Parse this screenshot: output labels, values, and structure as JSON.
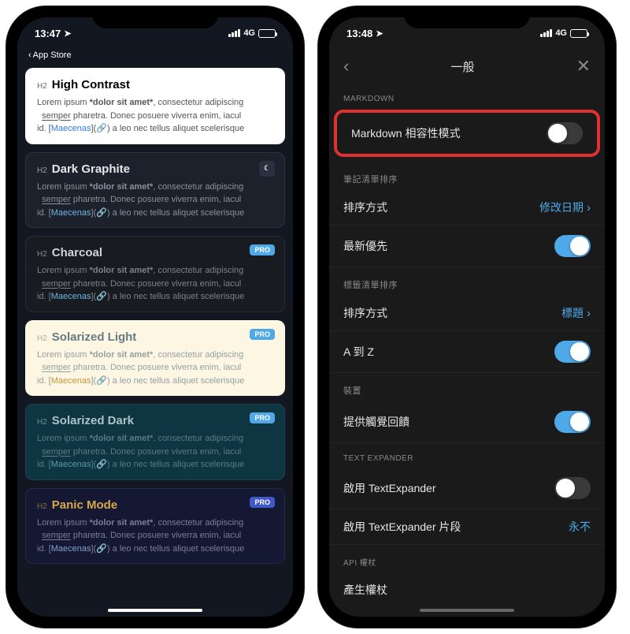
{
  "left": {
    "status": {
      "time": "13:47",
      "network": "4G",
      "back_label": "App Store"
    },
    "sample": {
      "h2": "H2",
      "l1a": "Lorem ipsum ",
      "l1b": "*dolor sit amet*",
      "l1c": ", consectetur adipiscing",
      "l2a": "semper",
      "l2b": "  pharetra. Donec posuere viverra enim, iacul",
      "l3a": "id. [",
      "l3b": "Maecenas",
      "l3c": "](",
      "l3d": ") a leo nec tellus aliquet scelerisque"
    },
    "themes": [
      {
        "name": "High Contrast",
        "cls": "theme-highcontrast",
        "badge": null
      },
      {
        "name": "Dark Graphite",
        "cls": "theme-darkgraphite",
        "badge": "moon"
      },
      {
        "name": "Charcoal",
        "cls": "theme-charcoal",
        "badge": "PRO"
      },
      {
        "name": "Solarized Light",
        "cls": "theme-solarlight",
        "badge": "PRO"
      },
      {
        "name": "Solarized Dark",
        "cls": "theme-solardark",
        "badge": "PRO"
      },
      {
        "name": "Panic Mode",
        "cls": "theme-panic",
        "badge": "PRO"
      }
    ]
  },
  "right": {
    "status": {
      "time": "13:48",
      "network": "4G"
    },
    "nav_title": "一般",
    "sections": {
      "markdown_header": "MARKDOWN",
      "markdown_compat": "Markdown 相容性模式",
      "notes_sort_header": "筆記清單排序",
      "sort_method": "排序方式",
      "sort_value": "修改日期",
      "newest_first": "最新優先",
      "tags_sort_header": "標籤清單排序",
      "tags_sort_value": "標題",
      "a_to_z": "A 到 Z",
      "device_header": "裝置",
      "haptic": "提供觸覺回饋",
      "textexpander_header": "TEXT EXPANDER",
      "enable_te": "啟用 TextExpander",
      "enable_te_snippet": "啟用 TextExpander 片段",
      "te_snippet_value": "永不",
      "api_header": "API 權杖",
      "gen_token": "產生權杖"
    }
  }
}
